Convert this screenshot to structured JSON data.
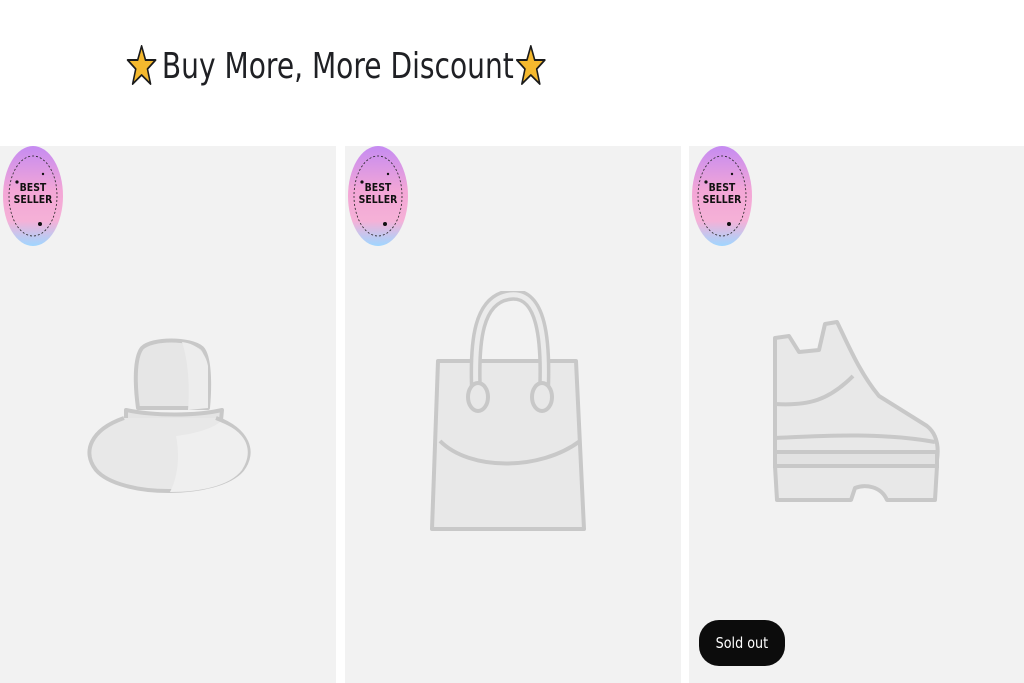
{
  "promo": {
    "heading": "Buy More, More Discount",
    "star_icon": "star-icon",
    "star_color": "#f5b92e"
  },
  "products": [
    {
      "icon": "hat-icon",
      "badge": "BEST SELLER",
      "sold_out": false
    },
    {
      "icon": "handbag-icon",
      "badge": "BEST SELLER",
      "sold_out": false
    },
    {
      "icon": "boot-icon",
      "badge": "BEST SELLER",
      "sold_out": true,
      "sold_out_label": "Sold out"
    }
  ],
  "colors": {
    "card_background": "#f2f2f2",
    "icon_stroke": "#cccccc",
    "sold_out_badge": "#0c0c0c"
  }
}
